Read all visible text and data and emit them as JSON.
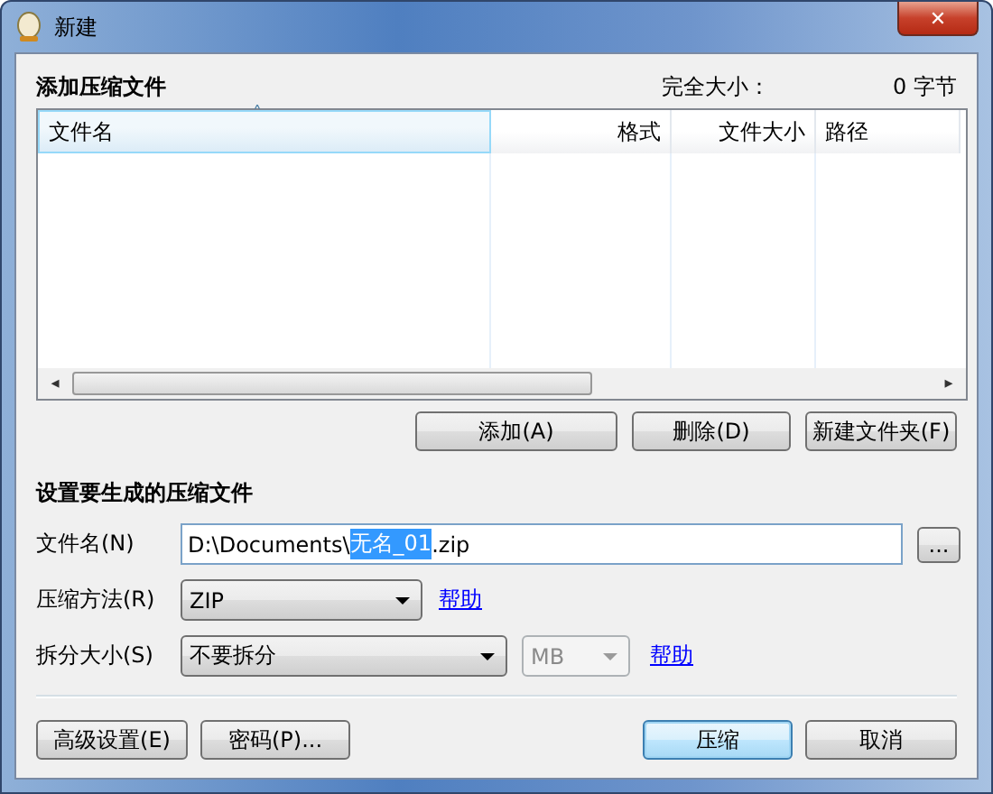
{
  "window": {
    "title": "新建",
    "close": "✕"
  },
  "files_section": {
    "heading": "添加压缩文件",
    "total_label": "完全大小：",
    "total_value": "0 字节",
    "columns": [
      {
        "label": "文件名",
        "sorted": true,
        "sort_mark": "˄"
      },
      {
        "label": "格式",
        "sorted": false
      },
      {
        "label": "文件大小",
        "sorted": false
      },
      {
        "label": "路径",
        "sorted": false
      }
    ],
    "scroll_left": "◂",
    "scroll_right": "▸",
    "buttons": [
      {
        "label": "添加(A)"
      },
      {
        "label": "删除(D)"
      },
      {
        "label": "新建文件夹(F)"
      }
    ]
  },
  "output_section": {
    "heading": "设置要生成的压缩文件",
    "filename": {
      "label": "文件名(N)",
      "value_parts": [
        {
          "text": "D:\\Documents\\",
          "selected": false
        },
        {
          "text": "无名_01",
          "selected": true
        },
        {
          "text": ".zip",
          "selected": false
        }
      ],
      "browse": "..."
    },
    "method": {
      "label": "压缩方法(R)",
      "value": "ZIP",
      "help": "帮助"
    },
    "split": {
      "label": "拆分大小(S)",
      "value": "不要拆分",
      "unit": {
        "value": "MB",
        "disabled": true
      },
      "help": "帮助"
    }
  },
  "footer": [
    {
      "label": "高级设置(E)",
      "default": false
    },
    {
      "label": "密码(P)...",
      "default": false
    },
    {
      "label": "压缩",
      "default": true
    },
    {
      "label": "取消",
      "default": false
    }
  ]
}
